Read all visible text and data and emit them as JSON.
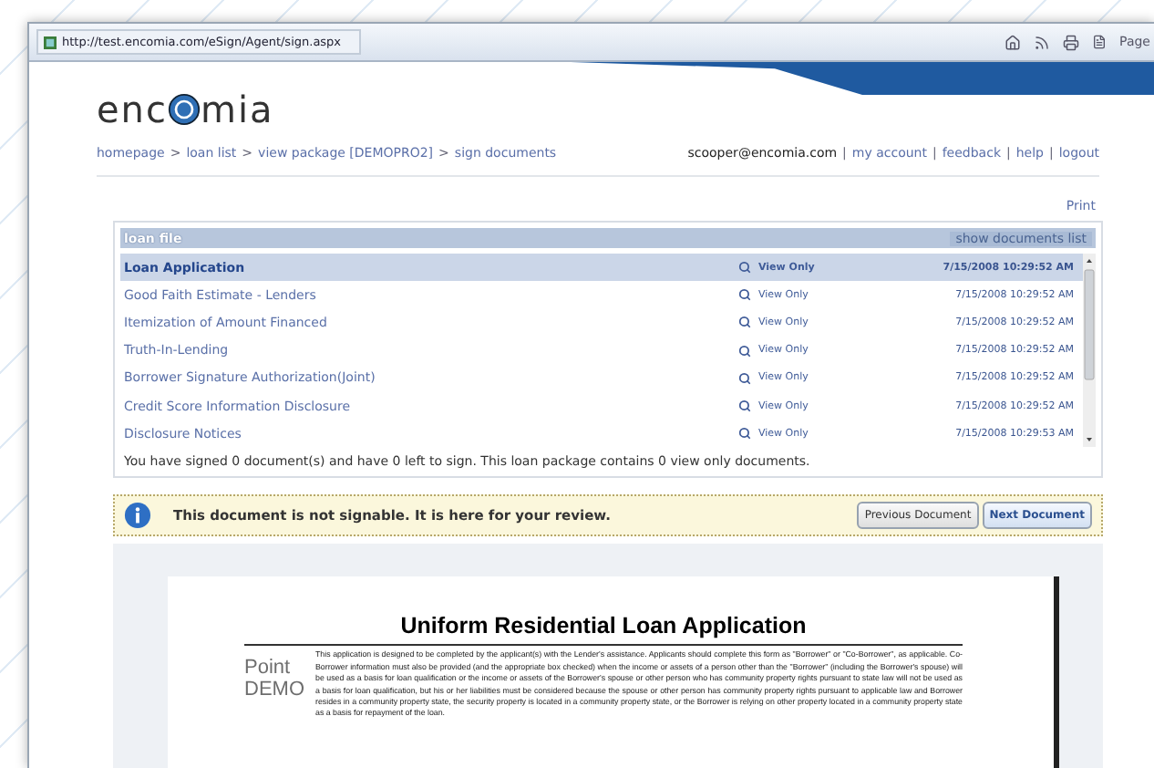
{
  "browser": {
    "address": "http://test.encomia.com/eSign/Agent/sign.aspx",
    "toolbar_label": "Page"
  },
  "header": {
    "logo_before": "enc",
    "logo_after": "mia",
    "breadcrumb": [
      {
        "label": "homepage"
      },
      {
        "label": "loan list"
      },
      {
        "label": "view package [DEMOPRO2]"
      },
      {
        "label": "sign documents"
      }
    ],
    "separator": ">",
    "user": "scooper@encomia.com",
    "divider": "|",
    "links": [
      {
        "label": "my account"
      },
      {
        "label": "feedback"
      },
      {
        "label": "help"
      },
      {
        "label": "logout"
      }
    ]
  },
  "print": "Print",
  "loan_file": {
    "title": "loan file",
    "toggle": "show documents list",
    "rows": [
      {
        "name": "Loan Application",
        "action": "View Only",
        "date": "7/15/2008 10:29:52 AM",
        "selected": true
      },
      {
        "name": "Good Faith Estimate - Lenders",
        "action": "View Only",
        "date": "7/15/2008 10:29:52 AM",
        "selected": false
      },
      {
        "name": "Itemization of Amount Financed",
        "action": "View Only",
        "date": "7/15/2008 10:29:52 AM",
        "selected": false
      },
      {
        "name": "Truth-In-Lending",
        "action": "View Only",
        "date": "7/15/2008 10:29:52 AM",
        "selected": false
      },
      {
        "name": "Borrower Signature Authorization(Joint)",
        "action": "View Only",
        "date": "7/15/2008 10:29:52 AM",
        "selected": false
      },
      {
        "name": "Credit Score Information Disclosure",
        "action": "View Only",
        "date": "7/15/2008 10:29:52 AM",
        "selected": false
      },
      {
        "name": "Disclosure Notices",
        "action": "View Only",
        "date": "7/15/2008 10:29:53 AM",
        "selected": false
      }
    ],
    "summary": "You have signed 0 document(s) and have 0 left to sign. This loan package contains 0 view only documents."
  },
  "notice": {
    "message": "This document is not signable. It is here for your review.",
    "buttons": [
      {
        "label": "Previous Document",
        "primary": false
      },
      {
        "label": "Next Document",
        "primary": true
      }
    ]
  },
  "document": {
    "title": "Uniform Residential Loan Application",
    "logo_lines": [
      "Point",
      "DEMO"
    ],
    "paragraph": "This application is designed to be completed by the applicant(s) with the Lender's assistance. Applicants should complete this form as \"Borrower\" or \"Co-Borrower\", as applicable. Co-Borrower information must also be provided (and the appropriate box checked) when the income or assets of a person other than the \"Borrower\" (including the Borrower's spouse) will be used as a basis for loan qualification or the income or assets of the Borrower's spouse or other person who has community property rights pursuant to state law will not be used as a basis for loan qualification, but his or her liabilities must be considered because the spouse or other person has community property rights pursuant to applicable law and Borrower resides in a community property state, the security property is located in a community property state, or the Borrower is relying on other property located in a community property state as a basis for repayment of the loan."
  }
}
